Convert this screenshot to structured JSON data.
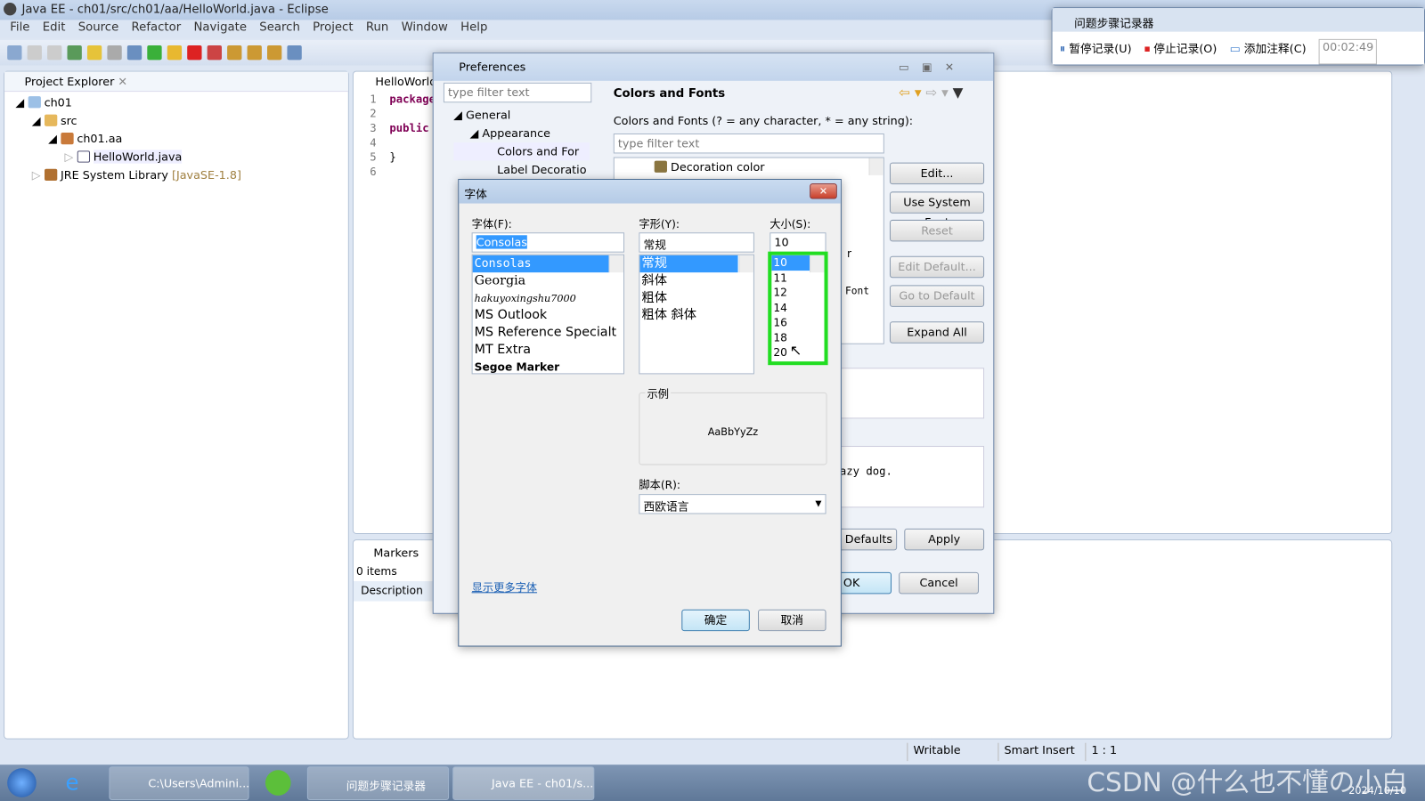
{
  "window": {
    "title": "Java EE - ch01/src/ch01/aa/HelloWorld.java - Eclipse"
  },
  "menu": [
    "File",
    "Edit",
    "Source",
    "Refactor",
    "Navigate",
    "Search",
    "Project",
    "Run",
    "Window",
    "Help"
  ],
  "project_explorer": {
    "title": "Project Explorer",
    "tree": [
      {
        "label": "ch01",
        "icon": "project-icon"
      },
      {
        "label": "src",
        "icon": "source-folder-icon"
      },
      {
        "label": "ch01.aa",
        "icon": "package-icon"
      },
      {
        "label": "HelloWorld.java",
        "icon": "java-file-icon"
      },
      {
        "label": "JRE System Library",
        "suffix": "[JavaSE-1.8]",
        "icon": "library-icon"
      }
    ]
  },
  "editor": {
    "tab": "HelloWorld",
    "lines": [
      {
        "n": "1",
        "code": "package"
      },
      {
        "n": "2",
        "code": ""
      },
      {
        "n": "3",
        "code": "public"
      },
      {
        "n": "4",
        "code": ""
      },
      {
        "n": "5",
        "code": "}"
      },
      {
        "n": "6",
        "code": ""
      }
    ],
    "preview_text": "azy dog."
  },
  "markers": {
    "title": "Markers",
    "count": "0 items",
    "column": "Description"
  },
  "status": {
    "writable": "Writable",
    "insert": "Smart Insert",
    "position": "1 : 1"
  },
  "recorder": {
    "title": "问题步骤记录器",
    "pause": "暂停记录(U)",
    "stop": "停止记录(O)",
    "comment": "添加注释(C)",
    "time": "00:02:49"
  },
  "preferences": {
    "title": "Preferences",
    "filter_placeholder": "type filter text",
    "tree": [
      "General",
      "Appearance",
      "Colors and For",
      "Label Decoratio"
    ],
    "page_title": "Colors and Fonts",
    "desc": "Colors and Fonts (? = any character, * = any string):",
    "list_filter_placeholder": "type filter text",
    "list_item": "Decoration color",
    "partial_r": "r",
    "partial_font": "Font",
    "buttons": {
      "edit": "Edit...",
      "system_font": "Use System Font",
      "reset": "Reset",
      "edit_default": "Edit Default...",
      "go_default": "Go to Default",
      "expand_all": "Expand All",
      "restore": "e Defaults",
      "apply": "Apply",
      "ok": "OK",
      "cancel": "Cancel"
    }
  },
  "font_dialog": {
    "title": "字体",
    "font_label": "字体(F):",
    "font_value": "Consolas",
    "fonts": [
      "Consolas",
      "Georgia",
      "hakuyoxingshu7000",
      "MS Outlook",
      "MS Reference Specialt",
      "MT Extra",
      "Segoe Marker"
    ],
    "style_label": "字形(Y):",
    "style_value": "常规",
    "styles": [
      "常规",
      "斜体",
      "粗体",
      "粗体 斜体"
    ],
    "size_label": "大小(S):",
    "size_value": "10",
    "sizes": [
      "10",
      "11",
      "12",
      "14",
      "16",
      "18",
      "20"
    ],
    "sample_label": "示例",
    "sample_text": "AaBbYyZz",
    "script_label": "脚本(R):",
    "script_value": "西欧语言",
    "more_fonts": "显示更多字体",
    "ok": "确定",
    "cancel": "取消",
    "highlight_color": "#22dd22"
  },
  "taskbar": {
    "items": [
      "C:\\Users\\Admini...",
      "问题步骤记录器",
      "Java EE - ch01/s..."
    ],
    "date": "2024/10/10",
    "watermark": "CSDN @什么也不懂の小白"
  }
}
